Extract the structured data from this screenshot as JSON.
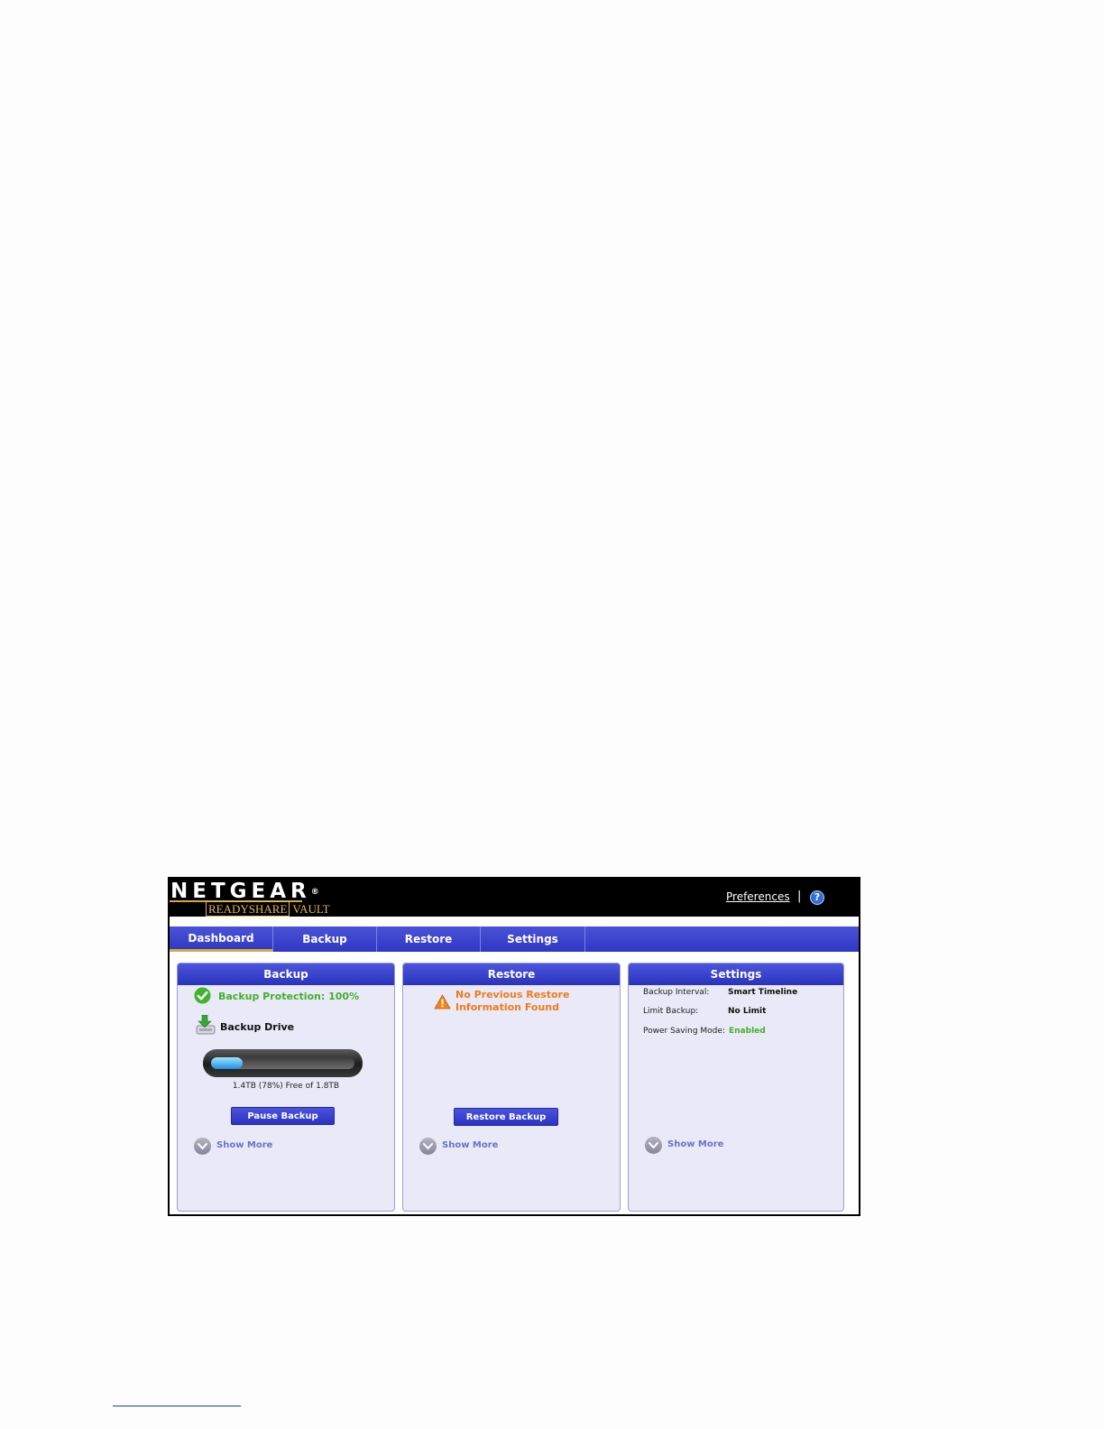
{
  "brand": {
    "logo_text": "NETGEAR",
    "logo_mark": "®",
    "product_boxed": "READYSHARE",
    "product_suffix": "VAULT",
    "accent_color": "#d6a93b"
  },
  "header": {
    "preferences_label": "Preferences",
    "separator": "|",
    "help_icon": "question-circle-icon",
    "help_glyph": "?"
  },
  "tabs": [
    {
      "label": "Dashboard",
      "active": true
    },
    {
      "label": "Backup",
      "active": false
    },
    {
      "label": "Restore",
      "active": false
    },
    {
      "label": "Settings",
      "active": false
    }
  ],
  "panels": {
    "backup": {
      "title": "Backup",
      "protection_text": "Backup Protection: 100%",
      "protection_icon": "check-circle-icon",
      "drive_label": "Backup Drive",
      "drive_icon": "drive-download-icon",
      "usage_fill_fraction": 0.22,
      "usage_text": "1.4TB (78%) Free of 1.8TB",
      "button_label": "Pause Backup",
      "show_more_label": "Show More"
    },
    "restore": {
      "title": "Restore",
      "warning_icon": "warning-triangle-icon",
      "message_line1": "No Previous Restore",
      "message_line2": "Information Found",
      "button_label": "Restore Backup",
      "show_more_label": "Show More"
    },
    "settings": {
      "title": "Settings",
      "rows": [
        {
          "label": "Backup Interval:",
          "value": "Smart Timeline"
        },
        {
          "label": "Limit Backup:",
          "value": "No Limit"
        },
        {
          "label": "Power Saving Mode:",
          "value": "Enabled"
        }
      ],
      "show_more_label": "Show More"
    }
  },
  "colors": {
    "tab_blue": "#2f37c4",
    "panel_bg": "#e9e9f7",
    "status_green": "#43b02a",
    "warning_orange": "#f07c17",
    "link_purple": "#6b73c8"
  }
}
